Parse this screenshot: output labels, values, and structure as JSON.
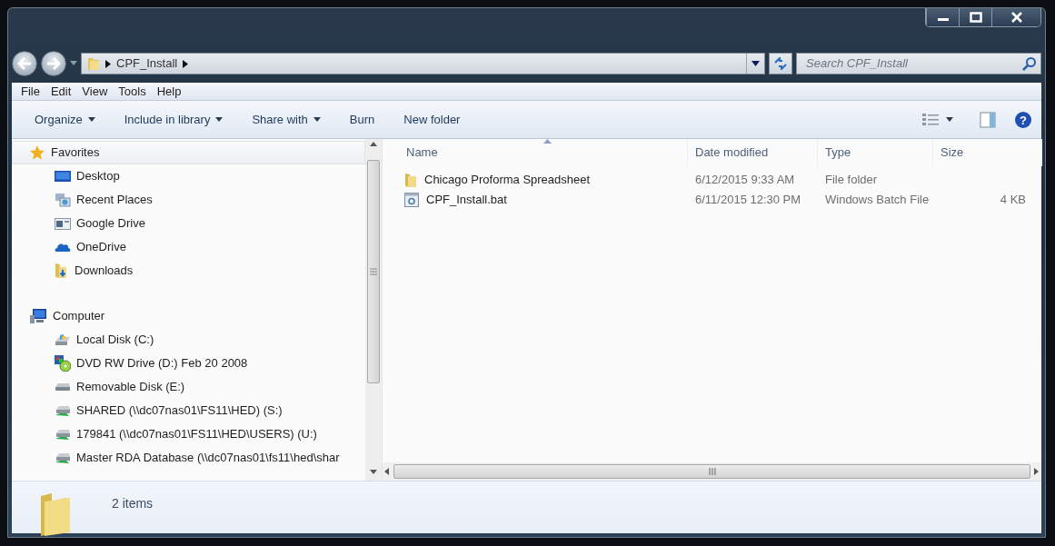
{
  "address": {
    "crumbs": [
      "CPF_Install"
    ]
  },
  "search": {
    "placeholder": "Search CPF_Install"
  },
  "help": {
    "glyph": "?"
  },
  "menu": [
    "File",
    "Edit",
    "View",
    "Tools",
    "Help"
  ],
  "toolbar": [
    {
      "label": "Organize",
      "dropdown": true
    },
    {
      "label": "Include in library",
      "dropdown": true
    },
    {
      "label": "Share with",
      "dropdown": true
    },
    {
      "label": "Burn",
      "dropdown": false
    },
    {
      "label": "New folder",
      "dropdown": false
    }
  ],
  "sidebar": {
    "items": [
      {
        "label": "Favorites",
        "kind": "star",
        "selected": true,
        "children": [
          {
            "label": "Desktop",
            "kind": "desktop",
            "selected": false
          },
          {
            "label": "Recent Places",
            "kind": "recent",
            "selected": false
          },
          {
            "label": "Google Drive",
            "kind": "gdrive",
            "selected": false
          },
          {
            "label": "OneDrive",
            "kind": "cloud",
            "selected": false
          },
          {
            "label": "Downloads",
            "kind": "downloads",
            "selected": false
          }
        ]
      },
      {
        "label": "Computer",
        "kind": "computer",
        "selected": false,
        "children": [
          {
            "label": "Local Disk (C:)",
            "kind": "disk",
            "selected": false
          },
          {
            "label": "DVD RW Drive (D:) Feb 20 2008",
            "kind": "dvd",
            "selected": false
          },
          {
            "label": "Removable Disk (E:)",
            "kind": "removable",
            "selected": false
          },
          {
            "label": "SHARED (\\\\dc07nas01\\FS11\\HED) (S:)",
            "kind": "network",
            "selected": false
          },
          {
            "label": "179841 (\\\\dc07nas01\\FS11\\HED\\USERS) (U:)",
            "kind": "network",
            "selected": false
          },
          {
            "label": "Master RDA Database (\\\\dc07nas01\\fs11\\hed\\shar",
            "kind": "network",
            "selected": false
          }
        ]
      }
    ]
  },
  "table": {
    "columns": [
      {
        "label": "Name",
        "sorted": true
      },
      {
        "label": "Date modified",
        "sorted": false
      },
      {
        "label": "Type",
        "sorted": false
      },
      {
        "label": "Size",
        "sorted": false
      }
    ],
    "rows": [
      {
        "kind": "folder",
        "name": "Chicago Proforma Spreadsheet",
        "date": "6/12/2015 9:33 AM",
        "type": "File folder"
      },
      {
        "kind": "batch",
        "name": "CPF_Install.bat",
        "date": "6/11/2015 12:30 PM",
        "type": "Windows Batch File",
        "size": "4 KB"
      }
    ]
  },
  "status_bar": {
    "text": "2 items"
  }
}
